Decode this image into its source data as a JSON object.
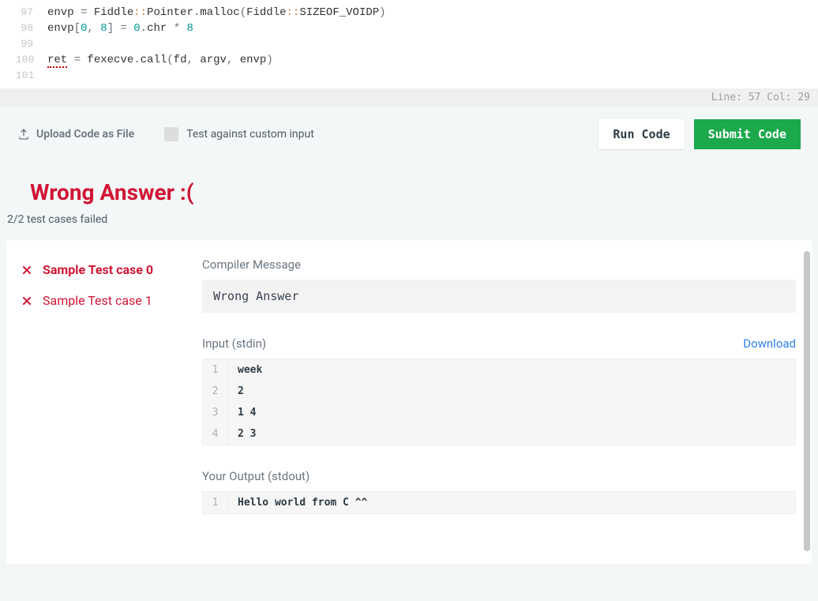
{
  "editor": {
    "lines": [
      {
        "n": 97,
        "tokens": [
          {
            "t": "envp ",
            "c": "tk-id"
          },
          {
            "t": "=",
            "c": "tk-op"
          },
          {
            "t": " Fiddle",
            "c": "tk-id"
          },
          {
            "t": "::",
            "c": "tk-scope"
          },
          {
            "t": "Pointer",
            "c": "tk-id"
          },
          {
            "t": ".",
            "c": "tk-op"
          },
          {
            "t": "malloc",
            "c": "tk-id"
          },
          {
            "t": "(",
            "c": "tk-op"
          },
          {
            "t": "Fiddle",
            "c": "tk-id"
          },
          {
            "t": "::",
            "c": "tk-scope"
          },
          {
            "t": "SIZEOF_VOIDP",
            "c": "tk-id"
          },
          {
            "t": ")",
            "c": "tk-op"
          }
        ]
      },
      {
        "n": 98,
        "tokens": [
          {
            "t": "envp",
            "c": "tk-id"
          },
          {
            "t": "[",
            "c": "tk-op"
          },
          {
            "t": "0",
            "c": "tk-num"
          },
          {
            "t": ", ",
            "c": "tk-op"
          },
          {
            "t": "8",
            "c": "tk-num"
          },
          {
            "t": "] ",
            "c": "tk-op"
          },
          {
            "t": "=",
            "c": "tk-op"
          },
          {
            "t": " ",
            "c": "tk-id"
          },
          {
            "t": "0",
            "c": "tk-num"
          },
          {
            "t": ".",
            "c": "tk-op"
          },
          {
            "t": "chr ",
            "c": "tk-id"
          },
          {
            "t": "*",
            "c": "tk-op"
          },
          {
            "t": " ",
            "c": "tk-id"
          },
          {
            "t": "8",
            "c": "tk-num"
          }
        ]
      },
      {
        "n": 99,
        "tokens": []
      },
      {
        "n": 100,
        "tokens": [
          {
            "t": "ret",
            "c": "tk-err"
          },
          {
            "t": " ",
            "c": "tk-id"
          },
          {
            "t": "=",
            "c": "tk-op"
          },
          {
            "t": " fexecve",
            "c": "tk-id"
          },
          {
            "t": ".",
            "c": "tk-op"
          },
          {
            "t": "call",
            "c": "tk-id"
          },
          {
            "t": "(",
            "c": "tk-op"
          },
          {
            "t": "fd",
            "c": "tk-id"
          },
          {
            "t": ",",
            "c": "tk-op"
          },
          {
            "t": " argv",
            "c": "tk-id"
          },
          {
            "t": ",",
            "c": "tk-op"
          },
          {
            "t": " envp",
            "c": "tk-id"
          },
          {
            "t": ")",
            "c": "tk-op"
          }
        ]
      },
      {
        "n": 101,
        "tokens": []
      }
    ],
    "status": "Line: 57 Col: 29"
  },
  "actions": {
    "upload": "Upload Code as File",
    "custom_input": "Test against custom input",
    "run": "Run Code",
    "submit": "Submit Code"
  },
  "result": {
    "title": "Wrong Answer :(",
    "summary": "2/2 test cases failed",
    "testcases": [
      {
        "label": "Sample Test case 0",
        "active": true
      },
      {
        "label": "Sample Test case 1",
        "active": false
      }
    ],
    "compiler_label": "Compiler Message",
    "compiler_msg": "Wrong Answer",
    "input_label": "Input (stdin)",
    "download": "Download",
    "input_lines": [
      "week",
      "2",
      "1 4",
      "2 3"
    ],
    "output_label": "Your Output (stdout)",
    "output_lines": [
      "Hello world from C ^^"
    ]
  }
}
